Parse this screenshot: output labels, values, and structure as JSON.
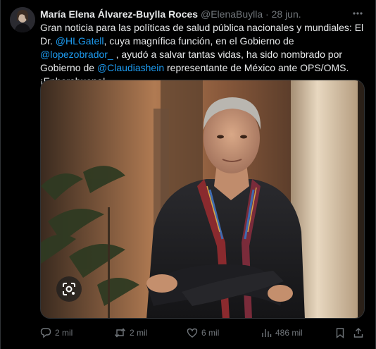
{
  "tweet": {
    "author_name": "María Elena Álvarez-Buylla Roces",
    "author_handle": "@ElenaBuylla",
    "separator": "·",
    "date": "28 jun.",
    "text_parts": {
      "p1": "Gran noticia para las políticas de salud pública nacionales y mundiales: El Dr. ",
      "m1": "@HLGatell",
      "p2": ", cuya magnífica función, en el Gobierno de ",
      "m2": "@lopezobrador_",
      "p3": " , ayudó a salvar tantas vidas, ha sido nombrado por Gobierno de ",
      "m3": "@Claudiashein",
      "p4": " representante de México ante OPS/OMS.¡Enhorabuena!"
    },
    "more_label": "···"
  },
  "actions": {
    "replies": "2 mil",
    "reposts": "2 mil",
    "likes": "6 mil",
    "views": "486 mil"
  },
  "icons": {
    "avatar": "avatar",
    "more": "more-icon",
    "lens": "google-lens-icon",
    "reply": "reply-icon",
    "repost": "repost-icon",
    "like": "heart-icon",
    "views": "views-chart-icon",
    "bookmark": "bookmark-icon",
    "share": "share-icon"
  },
  "colors": {
    "background": "#000000",
    "text": "#e7e9ea",
    "muted": "#71767b",
    "link": "#1d9bf0"
  }
}
